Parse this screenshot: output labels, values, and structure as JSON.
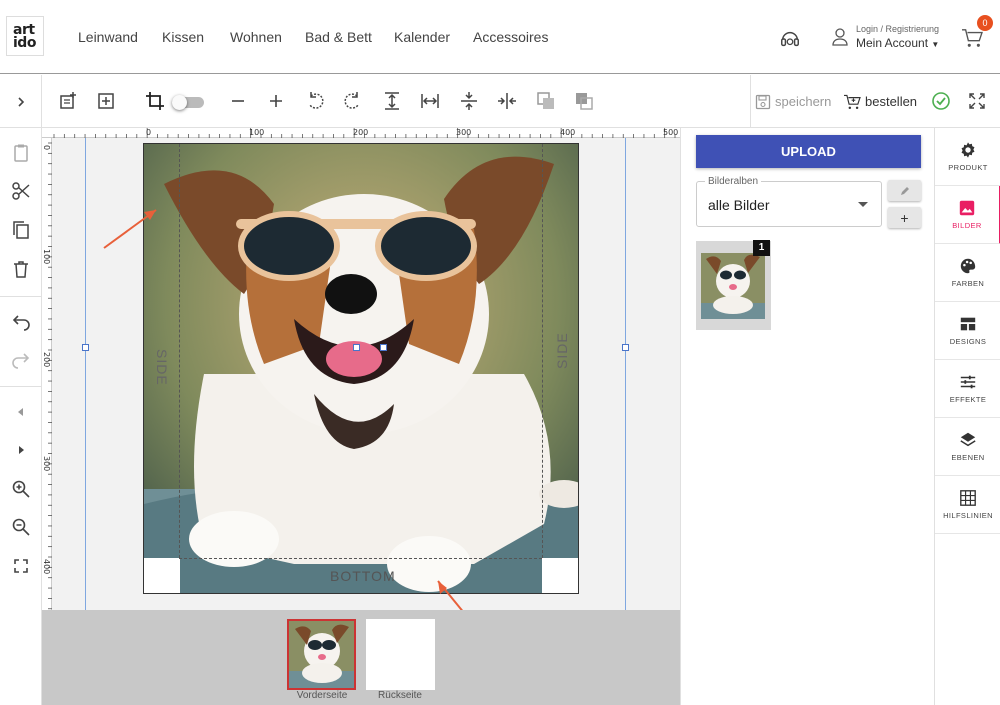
{
  "brand": {
    "logo_line1": "art",
    "logo_line2": "ido"
  },
  "nav": {
    "items": [
      "Leinwand",
      "Kissen",
      "Wohnen",
      "Bad & Bett",
      "Kalender",
      "Accessoires"
    ],
    "login_label": "Login / Registrierung",
    "account_label": "Mein Account",
    "cart_count": "0"
  },
  "toolbar": {
    "save_label": "speichern",
    "order_label": "bestellen",
    "icons": [
      "add-text-icon",
      "add-box-icon",
      "crop-icon",
      "toggle-switch",
      "zoom-out-icon",
      "zoom-in-icon",
      "rotate-left-icon",
      "rotate-right-icon",
      "fit-height-icon",
      "fit-width-icon",
      "center-vertical-icon",
      "center-horizontal-icon",
      "send-back-icon",
      "bring-front-icon",
      "check-circle-icon",
      "fullscreen-icon"
    ]
  },
  "canvas": {
    "ruler_top": [
      "0",
      "100",
      "200",
      "300",
      "400",
      "500"
    ],
    "ruler_left": [
      "0",
      "100",
      "200",
      "300",
      "400"
    ],
    "side_left_label": "SIDE",
    "side_right_label": "SIDE",
    "bottom_label": "BOTTOM"
  },
  "pages": [
    {
      "label": "Vorderseite",
      "active": true
    },
    {
      "label": "Rückseite",
      "active": false
    }
  ],
  "panel": {
    "upload_label": "UPLOAD",
    "album_legend": "Bilderalben",
    "album_value": "alle Bilder",
    "add_label": "+",
    "image_count": "1"
  },
  "tabs": [
    {
      "label": "PRODUKT",
      "icon": "gear-icon",
      "active": false
    },
    {
      "label": "BILDER",
      "icon": "image-icon",
      "active": true
    },
    {
      "label": "FARBEN",
      "icon": "palette-icon",
      "active": false
    },
    {
      "label": "DESIGNS",
      "icon": "layout-icon",
      "active": false
    },
    {
      "label": "EFFEKTE",
      "icon": "sliders-icon",
      "active": false
    },
    {
      "label": "EBENEN",
      "icon": "layers-icon",
      "active": false
    },
    {
      "label": "HILFSLINIEN",
      "icon": "grid-icon",
      "active": false
    }
  ],
  "colors": {
    "accent": "#3f51b5",
    "active_tab": "#e91e63",
    "badge": "#e8501f",
    "annotation_arrow": "#e8603a",
    "check": "#4caf50"
  }
}
